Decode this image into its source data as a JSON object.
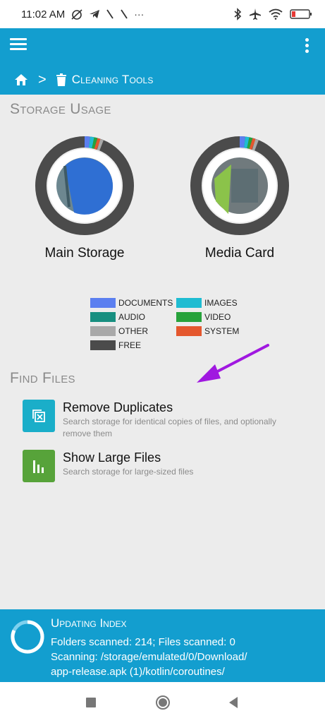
{
  "status_bar": {
    "time": "11:02 AM",
    "left_icons": [
      "alarm-off-icon",
      "telegram-icon",
      "signal-icon",
      "signal-icon",
      "more-notifications-icon"
    ],
    "right_icons": [
      "bluetooth-icon",
      "airplane-icon",
      "wifi-icon",
      "battery-icon"
    ]
  },
  "app_bar": {
    "menu_icon": "hamburger-menu-icon",
    "overflow_icon": "more-vert-icon"
  },
  "breadcrumb": {
    "home_icon": "home-icon",
    "separator": ">",
    "item_icon": "trash-icon",
    "label": "Cleaning Tools"
  },
  "storage": {
    "title": "Storage Usage",
    "items": [
      {
        "label": "Main Storage"
      },
      {
        "label": "Media Card"
      }
    ]
  },
  "legend": {
    "items": [
      {
        "label": "DOCUMENTS",
        "color": "#5b7ff0"
      },
      {
        "label": "IMAGES",
        "color": "#1fbcd2"
      },
      {
        "label": "AUDIO",
        "color": "#178f80"
      },
      {
        "label": "VIDEO",
        "color": "#27a23b"
      },
      {
        "label": "OTHER",
        "color": "#a9a9a9"
      },
      {
        "label": "SYSTEM",
        "color": "#e4572e"
      },
      {
        "label": "FREE",
        "color": "#4b4b4b"
      }
    ]
  },
  "find_files": {
    "title": "Find Files",
    "items": [
      {
        "title": "Remove Duplicates",
        "subtitle_line1": "Search storage for identical copies of files, and optionally",
        "subtitle_line2": "remove them",
        "icon": "duplicates-icon",
        "color": "#1aaec9"
      },
      {
        "title": "Show Large Files",
        "subtitle_line1": "Search storage for large-sized files",
        "icon": "bar-chart-icon",
        "color": "#57a33a"
      }
    ]
  },
  "index": {
    "title": "Updating Index",
    "line1": "Folders scanned: 214; Files scanned: 0",
    "line2": "Scanning: /storage/emulated/0/Download/",
    "line3": "app-release.apk (1)/kotlin/coroutines/"
  },
  "nav": {
    "buttons": [
      "recents-icon",
      "home-circle-icon",
      "back-icon"
    ]
  },
  "colors": {
    "accent": "#139ecf",
    "annotation_arrow": "#a018e0"
  }
}
